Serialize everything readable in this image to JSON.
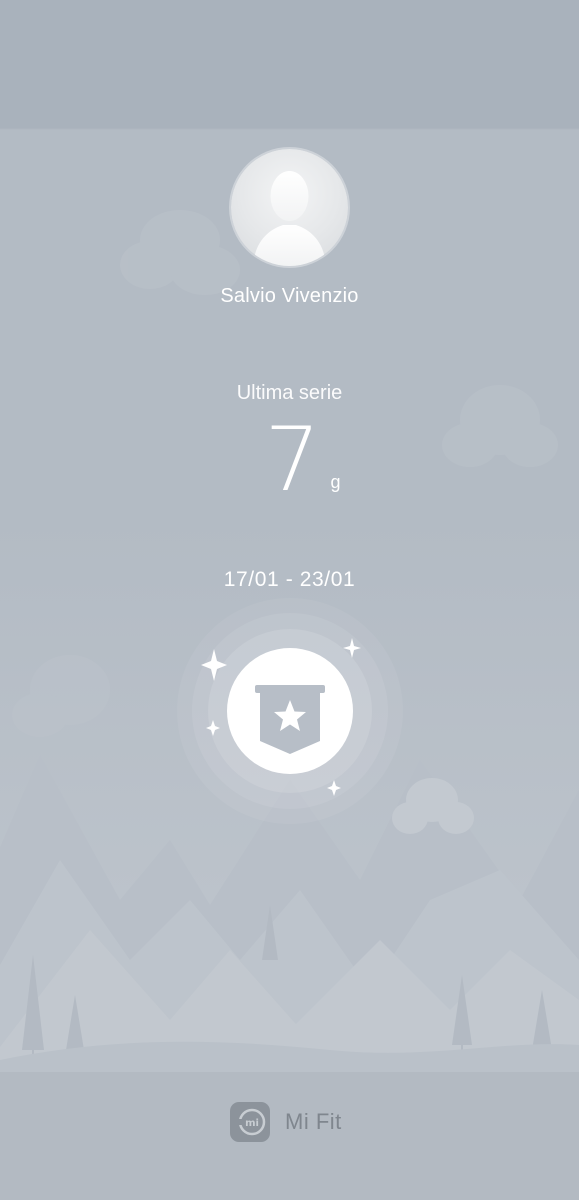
{
  "profile": {
    "name": "Salvio Vivenzio"
  },
  "streak": {
    "label": "Ultima serie",
    "value": "7",
    "unit": "g"
  },
  "period": {
    "range": "17/01 - 23/01"
  },
  "badge": {
    "icon": "star-banner-icon"
  },
  "footer": {
    "app_name": "Mi Fit",
    "logo_text": "mi"
  },
  "colors": {
    "background": "#b3bbc4",
    "text": "#ffffff",
    "footer_text": "#7f868e"
  }
}
